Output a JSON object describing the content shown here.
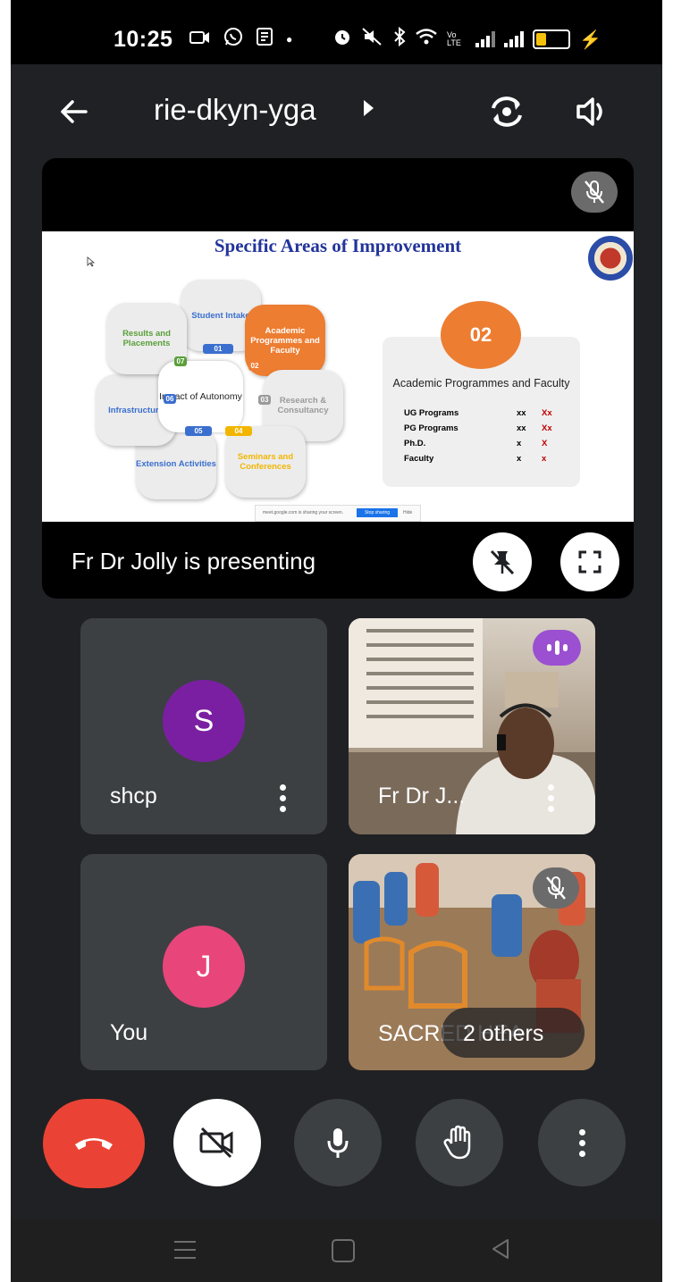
{
  "status_bar": {
    "time": "10:25",
    "network_label": "Vo LTE"
  },
  "header": {
    "meeting_code": "rie-dkyn-yga"
  },
  "presentation": {
    "slide": {
      "title": "Specific Areas of Improvement",
      "hub_label": "Impact of Autonomy",
      "petals": [
        {
          "label": "Student Intake",
          "number": "01"
        },
        {
          "label": "Academic Programmes and Faculty",
          "number": "02"
        },
        {
          "label": "Research & Consultancy",
          "number": "03"
        },
        {
          "label": "Seminars and Conferences",
          "number": "04"
        },
        {
          "label": "Extension Activities",
          "number": "05"
        },
        {
          "label": "Infrastructure",
          "number": "06"
        },
        {
          "label": "Results and Placements",
          "number": "07"
        }
      ],
      "info": {
        "number": "02",
        "title": "Academic Programmes and Faculty",
        "rows": [
          {
            "label": "UG Programs",
            "a": "xx",
            "b": "Xx"
          },
          {
            "label": "PG Programs",
            "a": "xx",
            "b": "Xx"
          },
          {
            "label": "Ph.D.",
            "a": "x",
            "b": "X"
          },
          {
            "label": "Faculty",
            "a": "x",
            "b": "x"
          }
        ]
      },
      "share_bar": {
        "text": "meet.google.com is sharing your screen.",
        "stop_label": "Stop sharing",
        "hide_label": "Hide"
      }
    },
    "presenter_label": "Fr Dr Jolly is presenting"
  },
  "participants": [
    {
      "name": "shcp",
      "initial": "S",
      "avatar_color": "#7b1fa2"
    },
    {
      "name": "Fr Dr J...",
      "initial": ""
    },
    {
      "name": "You",
      "initial": "J",
      "avatar_color": "#e8457b"
    },
    {
      "name": "SACRED HEA",
      "initial": ""
    }
  ],
  "others_label": "2 others",
  "colors": {
    "end_call": "#ea4335",
    "speaking": "#9b4fd1",
    "tile_bg": "#3c4043",
    "app_bg": "#202124"
  }
}
